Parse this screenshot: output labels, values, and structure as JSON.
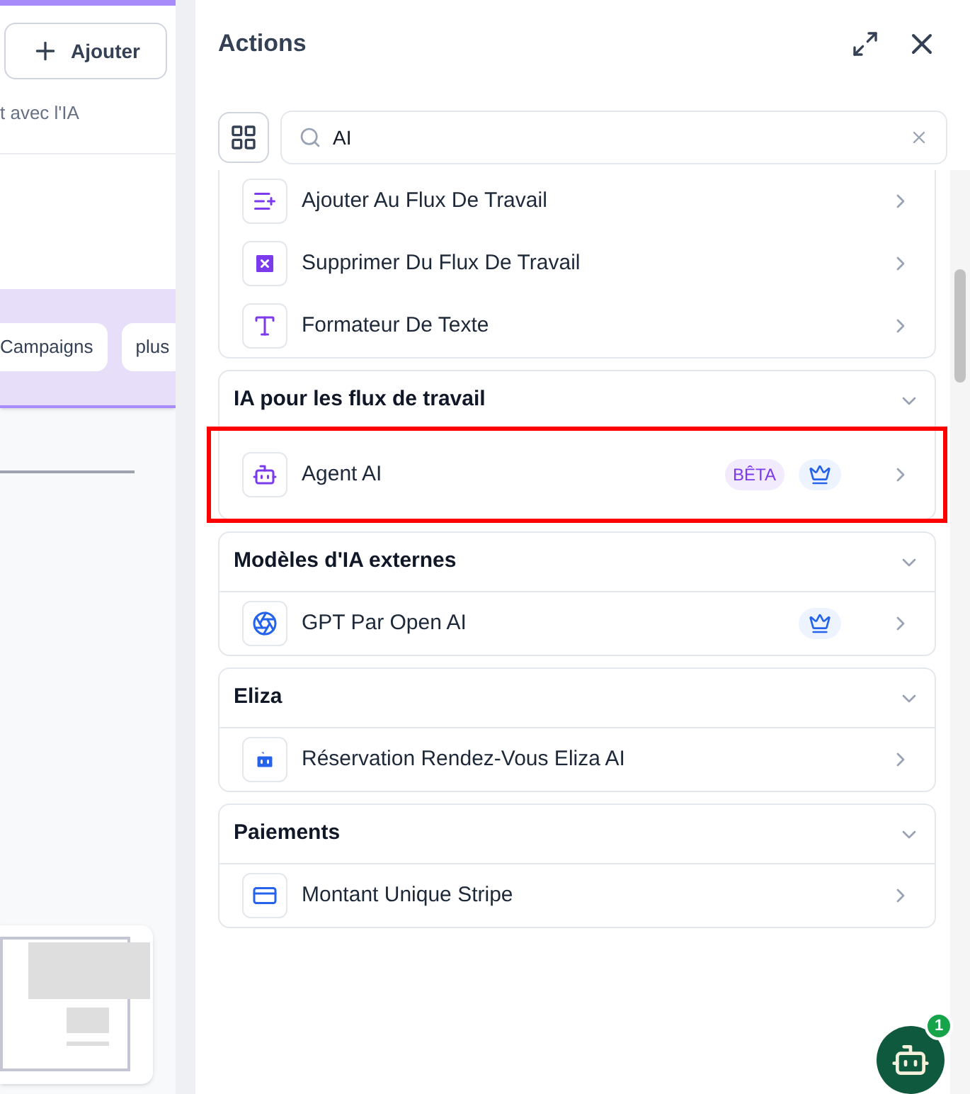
{
  "canvas": {
    "add_button": "Ajouter",
    "subtitle": "t avec l'IA",
    "chips": [
      "Campaigns",
      "plus"
    ]
  },
  "panel": {
    "title": "Actions",
    "search": {
      "value": "AI"
    },
    "groups": [
      {
        "items": [
          {
            "kind": "workflow-add",
            "label": "Ajouter Au Flux De Travail",
            "premium": false,
            "highlighted": false
          },
          {
            "kind": "workflow-remove",
            "label": "Supprimer Du Flux De Travail",
            "premium": false,
            "highlighted": false
          },
          {
            "kind": "text",
            "label": "Formateur De Texte",
            "premium": false,
            "highlighted": false
          }
        ]
      },
      {
        "title": "IA pour les flux de travail",
        "expanded": true,
        "items": [
          {
            "kind": "robot",
            "label": "Agent AI",
            "beta": "BÊTA",
            "premium": true,
            "highlighted": true
          }
        ]
      },
      {
        "title": "Modèles d'IA externes",
        "expanded": true,
        "items": [
          {
            "kind": "spiral",
            "label": "GPT Par Open AI",
            "premium": true,
            "highlighted": false
          }
        ]
      },
      {
        "title": "Eliza",
        "expanded": true,
        "items": [
          {
            "kind": "robot-filled",
            "label": "Réservation Rendez-Vous Eliza AI",
            "premium": false,
            "highlighted": false
          }
        ]
      },
      {
        "title": "Paiements",
        "expanded": true,
        "items": [
          {
            "kind": "card",
            "label": "Montant Unique Stripe",
            "premium": false,
            "highlighted": false
          }
        ]
      }
    ]
  },
  "chat": {
    "badge": "1"
  }
}
